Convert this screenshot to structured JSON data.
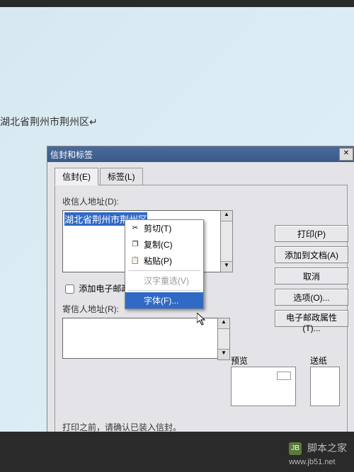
{
  "doc_text": "湖北省荆州市荆州区↵",
  "dialog": {
    "title": "信封和标签",
    "tabs": {
      "envelope": "信封(E)",
      "label": "标签(L)"
    },
    "recipient_label": "收信人地址(D):",
    "recipient_value": "湖北省荆州市荆州区",
    "add_epost": "添加电子邮政(C)",
    "sender_label": "寄信人地址(R):",
    "preview": "预览",
    "feed": "送纸",
    "status": "打印之前，请确认已装入信封。"
  },
  "buttons": {
    "print": "打印(P)",
    "add": "添加到文档(A)",
    "cancel": "取消",
    "options": "选项(O)...",
    "eprops": "电子邮政属性(T)..."
  },
  "context": {
    "cut": "剪切(T)",
    "copy": "复制(C)",
    "paste": "粘贴(P)",
    "reconvert": "汉字重选(V)",
    "font": "字体(F)..."
  },
  "watermark": "脚本之家",
  "watermark_url": "www.jb51.net"
}
